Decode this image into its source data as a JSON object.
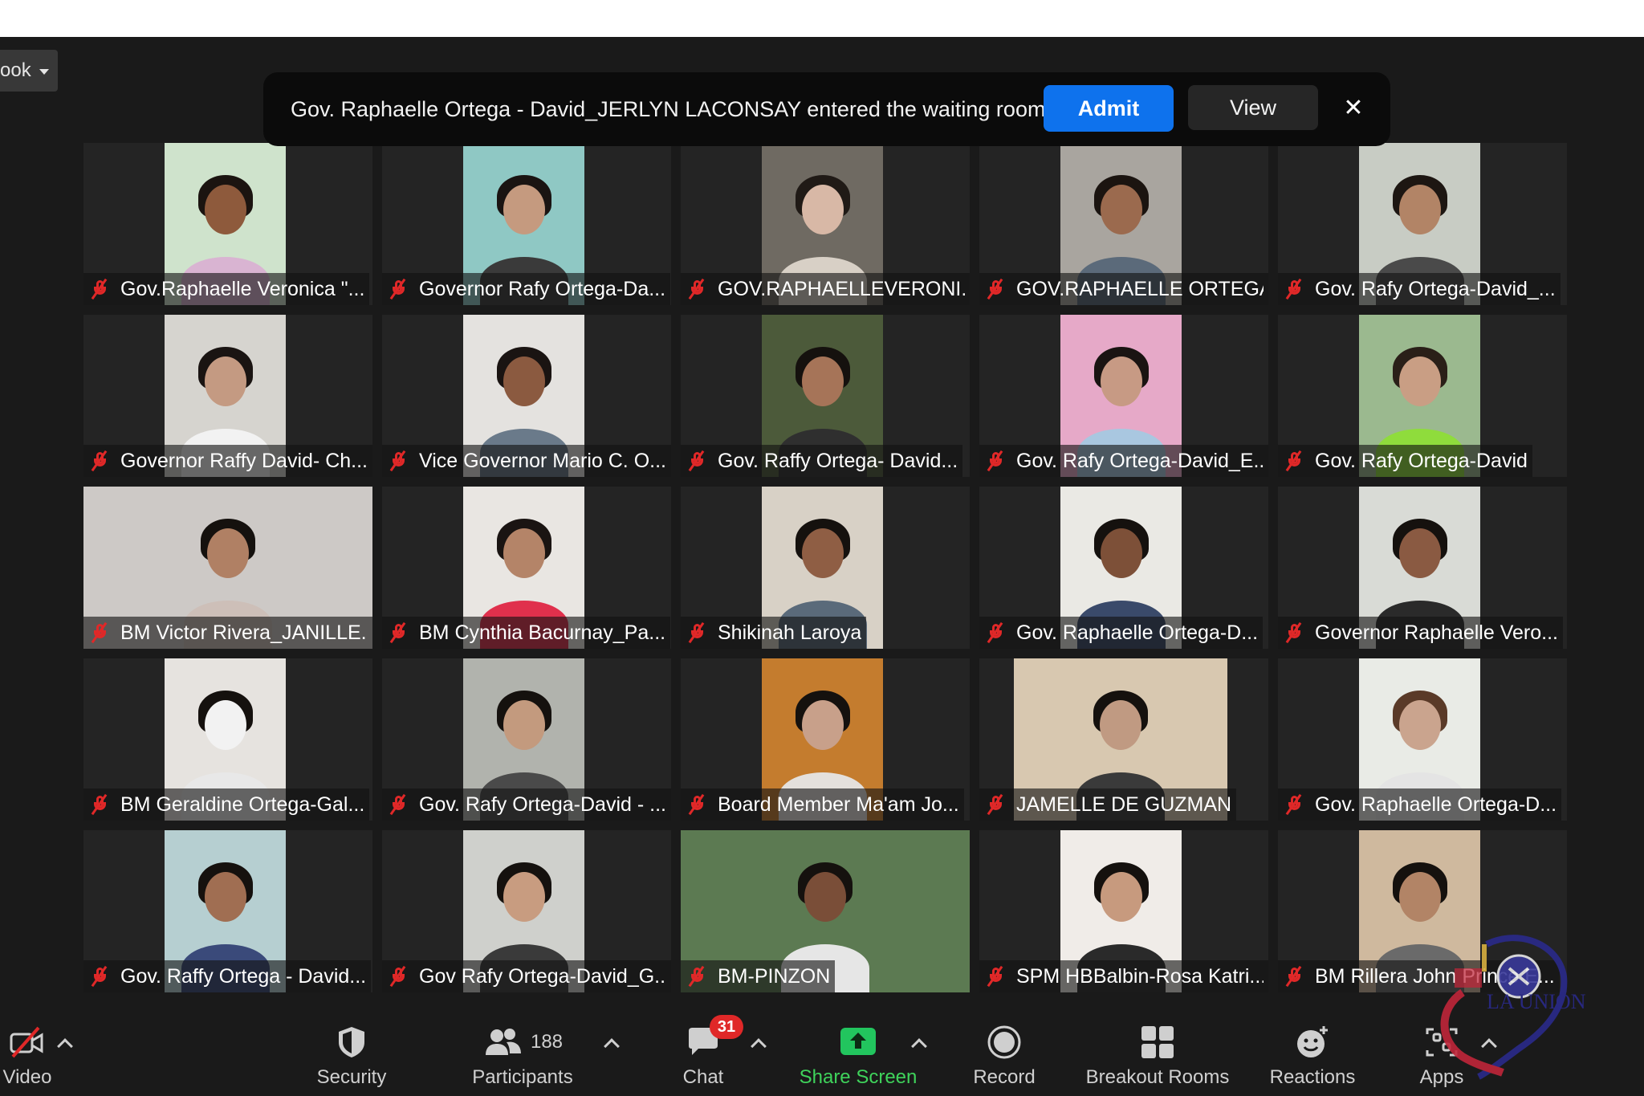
{
  "view_menu": {
    "label": "ook"
  },
  "notification": {
    "message": "Gov. Raphaelle Ortega - David_JERLYN LACONSAY entered the waiting room",
    "admit_label": "Admit",
    "view_label": "View",
    "close_glyph": "✕"
  },
  "participants": [
    {
      "name": "Gov.Raphaelle Veronica \"...",
      "bg": "#cfe3cc",
      "skin": "#8e5a3c",
      "hair": "#1b1410",
      "shirt": "#d9b4d2",
      "vx": 0.28,
      "vw": 0.42
    },
    {
      "name": "Governor Rafy Ortega-Da...",
      "bg": "#8fc8c4",
      "skin": "#c59a7f",
      "hair": "#1a1412",
      "shirt": "#3a3a3a",
      "vx": 0.28,
      "vw": 0.42
    },
    {
      "name": "GOV.RAPHAELLEVERONI...",
      "bg": "#6f6a62",
      "skin": "#d8b8a6",
      "hair": "#201a16",
      "shirt": "#d8d0c6",
      "vx": 0.28,
      "vw": 0.42
    },
    {
      "name": "GOV.RAPHAELLE ORTEGA...",
      "bg": "#a9a59f",
      "skin": "#9b6a4e",
      "hair": "#1b1410",
      "shirt": "#5b6a7a",
      "vx": 0.28,
      "vw": 0.42
    },
    {
      "name": "Gov. Rafy Ortega-David_...",
      "bg": "#c8ccc4",
      "skin": "#b28466",
      "hair": "#1d1612",
      "shirt": "#4a4a4a",
      "vx": 0.28,
      "vw": 0.42
    },
    {
      "name": "Governor Raffy David- Ch...",
      "bg": "#d6d4cf",
      "skin": "#c49a82",
      "hair": "#1a1412",
      "shirt": "#f2f2f2",
      "vx": 0.28,
      "vw": 0.42
    },
    {
      "name": "Vice Governor Mario C. O...",
      "bg": "#e4e2df",
      "skin": "#8b5a40",
      "hair": "#1a1412",
      "shirt": "#6a7a8a",
      "vx": 0.28,
      "vw": 0.42
    },
    {
      "name": "Gov. Raffy Ortega- David...",
      "bg": "#4c5a3a",
      "skin": "#a67458",
      "hair": "#15110e",
      "shirt": "#2f2f2f",
      "vx": 0.28,
      "vw": 0.42
    },
    {
      "name": "Gov. Rafy Ortega-David_E...",
      "bg": "#e6a9c8",
      "skin": "#c79a84",
      "hair": "#1a1412",
      "shirt": "#a9c7e0",
      "vx": 0.28,
      "vw": 0.42
    },
    {
      "name": "Gov. Rafy Ortega-David",
      "bg": "#9bb98f",
      "skin": "#c99e84",
      "hair": "#2a1f18",
      "shirt": "#8fdc3c",
      "vx": 0.28,
      "vw": 0.42
    },
    {
      "name": "BM Victor Rivera_JANILLE...",
      "bg": "#cdc9c6",
      "skin": "#b08064",
      "hair": "#15110e",
      "shirt": "#cdbfb8",
      "vx": 0.0,
      "vw": 1.0
    },
    {
      "name": "BM Cynthia Bacurnay_Pa...",
      "bg": "#e9e6e2",
      "skin": "#b48468",
      "hair": "#1a1412",
      "shirt": "#e0304c",
      "vx": 0.28,
      "vw": 0.42
    },
    {
      "name": "Shikinah Laroya",
      "bg": "#d8d1c6",
      "skin": "#8f5e44",
      "hair": "#15110e",
      "shirt": "#5a6a7a",
      "vx": 0.28,
      "vw": 0.42
    },
    {
      "name": "Gov. Raphaelle Ortega-D...",
      "bg": "#eae9e4",
      "skin": "#7d5038",
      "hair": "#15110e",
      "shirt": "#3a4a6a",
      "vx": 0.28,
      "vw": 0.42
    },
    {
      "name": "Governor Raphaelle Vero...",
      "bg": "#d9dbd6",
      "skin": "#8a5a42",
      "hair": "#15110e",
      "shirt": "#2a2a2a",
      "vx": 0.28,
      "vw": 0.42
    },
    {
      "name": "BM Geraldine Ortega-Gal...",
      "bg": "#e6e3df",
      "skin": "#f2f2f2",
      "hair": "#15110e",
      "shirt": "#e8e8e8",
      "vx": 0.28,
      "vw": 0.42
    },
    {
      "name": "Gov. Rafy Ortega-David - ...",
      "bg": "#b1b3ad",
      "skin": "#c39a7e",
      "hair": "#15110e",
      "shirt": "#4a4a4a",
      "vx": 0.28,
      "vw": 0.42
    },
    {
      "name": "Board Member Ma'am Jo...",
      "bg": "#c47c2e",
      "skin": "#c8a08a",
      "hair": "#15110e",
      "shirt": "#e4e0dc",
      "vx": 0.28,
      "vw": 0.42
    },
    {
      "name": "JAMELLE DE GUZMAN",
      "bg": "#d8c8b0",
      "skin": "#c09a82",
      "hair": "#15110e",
      "shirt": "#3a3a3a",
      "vx": 0.12,
      "vw": 0.74
    },
    {
      "name": "Gov. Raphaelle Ortega-D...",
      "bg": "#e9ebe6",
      "skin": "#caa48e",
      "hair": "#5a3a28",
      "shirt": "#e4e4e4",
      "vx": 0.28,
      "vw": 0.42
    },
    {
      "name": "Gov. Raffy Ortega - David...",
      "bg": "#b6cfd1",
      "skin": "#a06e52",
      "hair": "#15110e",
      "shirt": "#3a4a7a",
      "vx": 0.28,
      "vw": 0.42
    },
    {
      "name": "Gov Rafy Ortega-David_G...",
      "bg": "#cfd0cc",
      "skin": "#c89c80",
      "hair": "#15110e",
      "shirt": "#3a3a3a",
      "vx": 0.28,
      "vw": 0.42
    },
    {
      "name": "BM-PINZON",
      "bg": "#5c7a52",
      "skin": "#7a4e38",
      "hair": "#15110e",
      "shirt": "#e6e6e6",
      "vx": 0.0,
      "vw": 1.0
    },
    {
      "name": "SPM HBBalbin-Rosa Katri...",
      "bg": "#f0ece8",
      "skin": "#c79a7e",
      "hair": "#15110e",
      "shirt": "#2a2a2a",
      "vx": 0.28,
      "vw": 0.42
    },
    {
      "name": "BM Rillera John Prince E...",
      "bg": "#cfb99e",
      "skin": "#b28466",
      "hair": "#15110e",
      "shirt": "#6a6a6a",
      "vx": 0.28,
      "vw": 0.42
    }
  ],
  "toolbar": {
    "video_label": "Video",
    "security_label": "Security",
    "participants_count": "188",
    "participants_label": "Participants",
    "chat_badge": "31",
    "chat_label": "Chat",
    "share_label": "Share Screen",
    "record_label": "Record",
    "breakout_label": "Breakout Rooms",
    "reactions_label": "Reactions",
    "apps_label": "Apps"
  },
  "watermark": {
    "text": "LA UNION"
  },
  "colors": {
    "accent": "#0e72ed",
    "share_green": "#3fd35b",
    "muted_red": "#e02828",
    "background": "#1a1a1a",
    "tile": "#242424"
  },
  "icons": {
    "mic": "mic-muted-icon",
    "video": "video-off-icon",
    "security": "shield-icon",
    "participants": "people-icon",
    "chat": "chat-bubble-icon",
    "share": "share-screen-icon",
    "record": "record-icon",
    "breakout": "grid-icon",
    "reactions": "emoji-plus-icon",
    "apps": "apps-icon"
  }
}
